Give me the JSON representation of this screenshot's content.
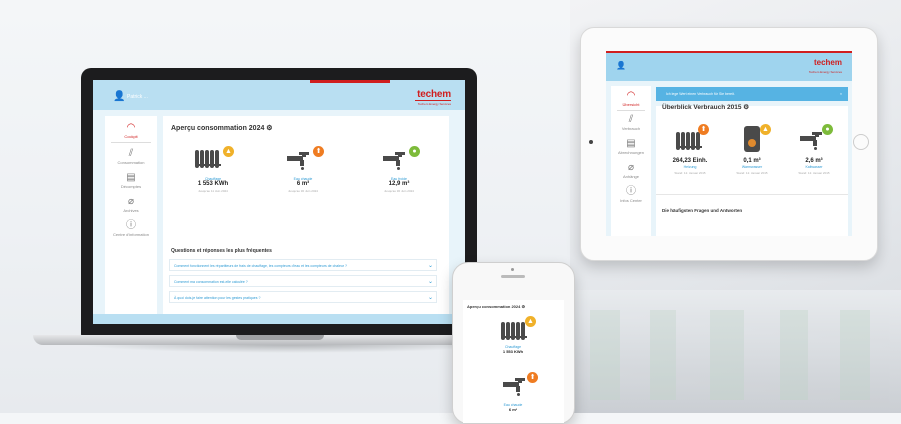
{
  "laptop": {
    "user_name": "Patrick ...",
    "logo": "techem",
    "logo_sub": "Techem Energy Services",
    "sidebar": [
      {
        "icon": "gauge-icon",
        "glyph": "◠",
        "label": "Cockpit",
        "active": true
      },
      {
        "icon": "chart-icon",
        "glyph": "⫽",
        "label": "Consommation",
        "active": false
      },
      {
        "icon": "document-icon",
        "glyph": "▤",
        "label": "Décomptes",
        "active": false
      },
      {
        "icon": "paperclip-icon",
        "glyph": "⌀",
        "label": "Archives",
        "active": false
      },
      {
        "icon": "info-icon",
        "glyph": "ⓘ",
        "label": "Centre d'information",
        "active": false
      }
    ],
    "title": "Aperçu consommation 2024 ⚙",
    "cards": [
      {
        "label": "Chauffage",
        "value": "1 553 KWh",
        "date": "Jusqu'au 11 Juin 2024",
        "badge": "#f0b12a"
      },
      {
        "label": "Eau chaude",
        "value": "6 m³",
        "date": "Jusqu'au 30 Juin 2024",
        "badge": "#ef7c22"
      },
      {
        "label": "Eau froide",
        "value": "12,9 m³",
        "date": "Jusqu'au 30 Juin 2024",
        "badge": "#7dbb3a"
      }
    ],
    "faq_title": "Questions et réponses les plus fréquentes",
    "faq": [
      "Comment fonctionnent les répartiteurs de frais de chauffage, les compteurs d'eau et les compteurs de chaleur ?",
      "Comment ma consommation est-elle calculée ?",
      "À quoi dois-je faire attention pour les gestes pratiques ?"
    ]
  },
  "tablet": {
    "logo": "techem",
    "logo_sub": "Techem Energy Services",
    "alert": "Ich lege Wert einen Verbrauch für Sie bereit.",
    "title": "Überblick Verbrauch 2015 ⚙",
    "sidebar": [
      {
        "icon": "gauge-icon",
        "glyph": "◠",
        "label": "Übersicht",
        "active": true
      },
      {
        "icon": "chart-icon",
        "glyph": "⫽",
        "label": "Verbrauch",
        "active": false
      },
      {
        "icon": "document-icon",
        "glyph": "▤",
        "label": "Abrechnungen",
        "active": false
      },
      {
        "icon": "paperclip-icon",
        "glyph": "⌀",
        "label": "Anhänge",
        "active": false
      },
      {
        "icon": "info-icon",
        "glyph": "ⓘ",
        "label": "Infos Center",
        "active": false
      }
    ],
    "cards": [
      {
        "value": "264,23 Einh.",
        "label": "Heizung",
        "date": "Stand: 12. Januar 2015",
        "badge": "#ef7c22"
      },
      {
        "value": "0,1 m³",
        "label": "Warmwasser",
        "date": "Stand: 12. Januar 2015",
        "badge": "#f0b12a"
      },
      {
        "value": "2,6 m³",
        "label": "Kaltwasser",
        "date": "Stand: 12. Januar 2015",
        "badge": "#7dbb3a"
      }
    ],
    "faq_title": "Die häufigsten Fragen und Antworten"
  },
  "phone": {
    "title": "Aperçu consommation 2024 ⚙",
    "cards": [
      {
        "label": "Chauffage",
        "value": "1 553 KWh",
        "badge": "#f0b12a"
      },
      {
        "label": "Eau chaude",
        "value": "6 m³",
        "badge": "#ef7c22"
      }
    ]
  }
}
